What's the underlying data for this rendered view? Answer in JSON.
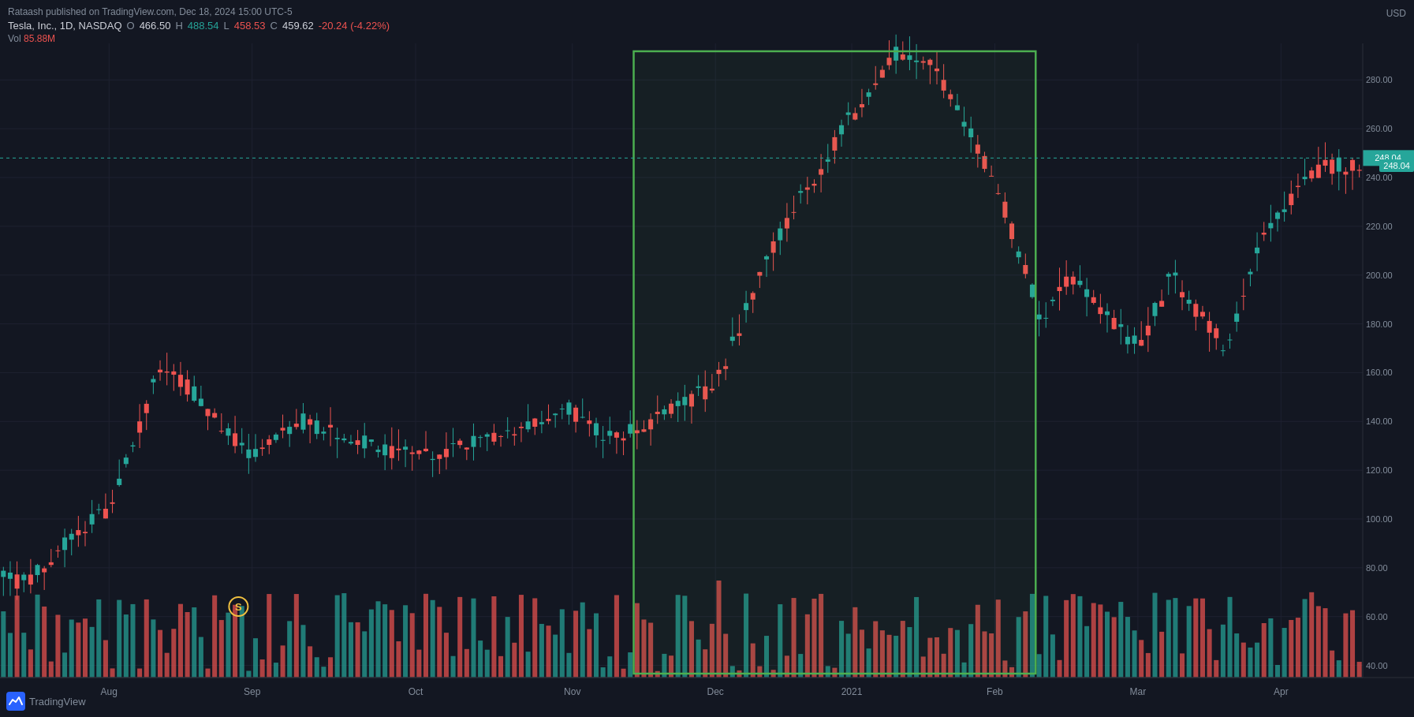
{
  "header": {
    "published_by": "Rataash published on TradingView.com, Dec 18, 2024 15:00 UTC-5",
    "symbol": "Tesla, Inc., 1D, NASDAQ",
    "open_label": "O",
    "open_val": "466.50",
    "high_label": "H",
    "high_val": "488.54",
    "low_label": "L",
    "low_val": "458.53",
    "close_label": "C",
    "close_val": "459.62",
    "change": "-20.24 (-4.22%)",
    "vol_label": "Vol",
    "vol_val": "85.88M",
    "currency": "USD",
    "price_tag": "248.04"
  },
  "xaxis": {
    "labels": [
      "Aug",
      "Sep",
      "Oct",
      "Nov",
      "Dec",
      "2021",
      "Feb",
      "Mar",
      "Apr"
    ]
  },
  "yaxis": {
    "labels": [
      "280.00",
      "260.00",
      "240.00",
      "220.00",
      "200.00",
      "180.00",
      "160.00",
      "140.00",
      "120.00",
      "100.00",
      "80.00",
      "60.00",
      "40.00"
    ]
  },
  "colors": {
    "up": "#26a69a",
    "down": "#ef5350",
    "bg": "#131722",
    "grid": "#1e2130",
    "green_box_border": "#4caf50",
    "price_tag_bg": "#26a69a"
  },
  "tradingview": {
    "logo_text": "TradingView"
  }
}
